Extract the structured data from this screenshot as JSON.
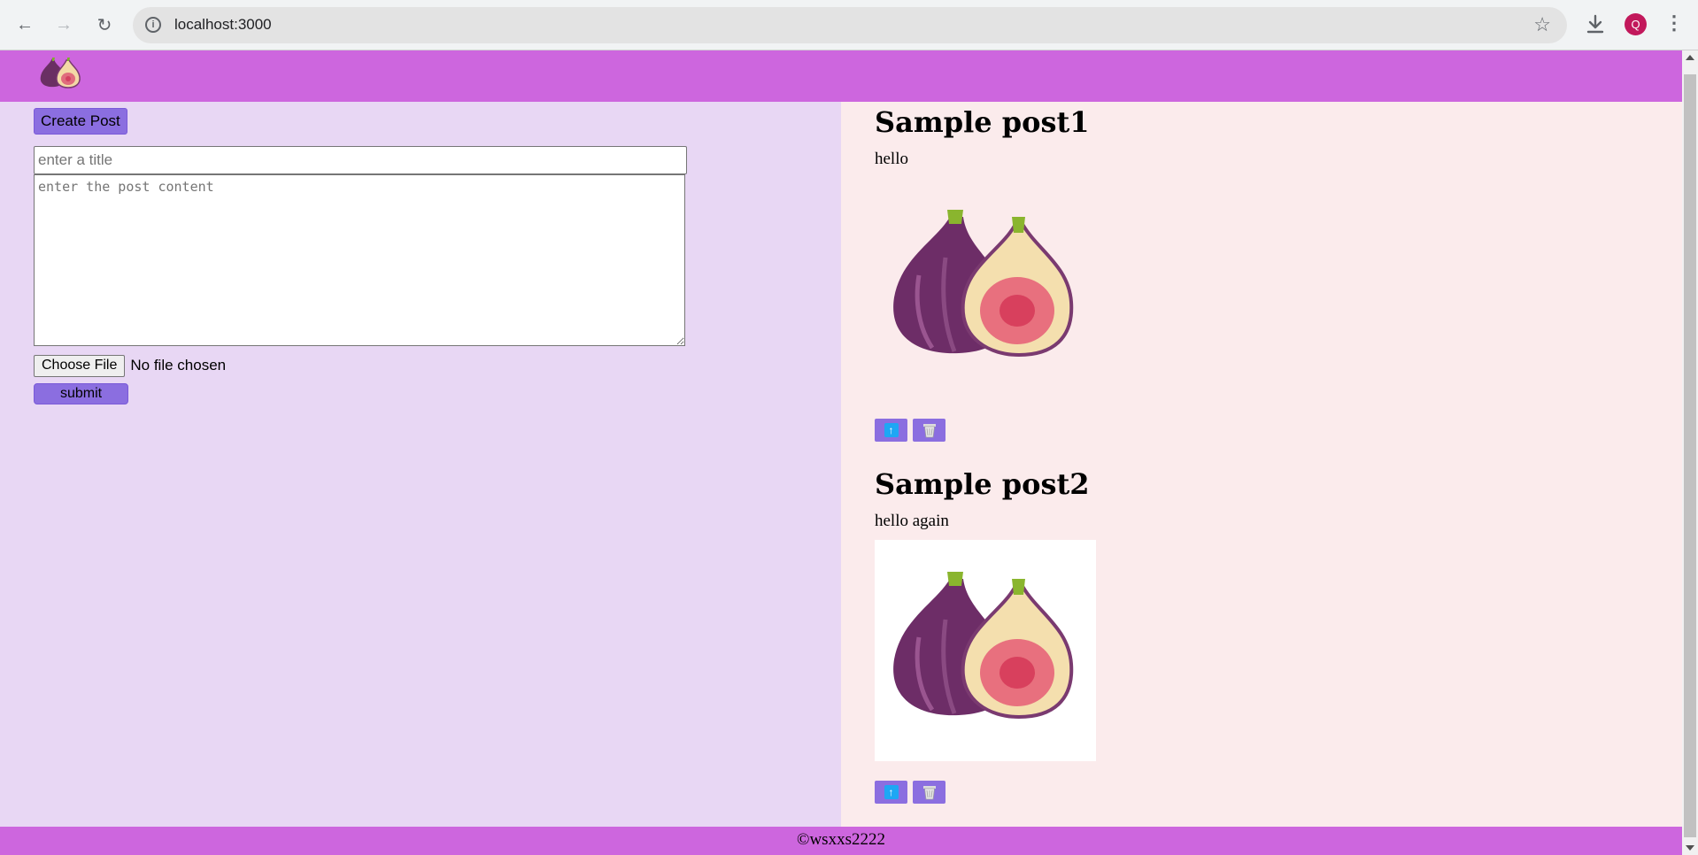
{
  "browser": {
    "url": "localhost:3000",
    "profile_initial": "Q"
  },
  "icons": {
    "back": "back-arrow-icon",
    "forward": "forward-arrow-icon",
    "reload": "reload-icon",
    "site_info": "info-icon",
    "bookmark": "star-icon",
    "download": "download-icon",
    "menu": "kebab-menu-icon",
    "logo": "fig-logo-icon",
    "upvote": "arrow-up-icon",
    "delete": "trash-icon"
  },
  "colors": {
    "header": "#cd66de",
    "left_pane": "#e8d7f4",
    "right_pane": "#fbebec",
    "button": "#8b6ee0"
  },
  "form": {
    "create_label": "Create Post",
    "title_placeholder": "enter a title",
    "content_placeholder": "enter the post content",
    "choose_file_label": "Choose File",
    "file_status": "No file chosen",
    "submit_label": "submit"
  },
  "posts": [
    {
      "title": "Sample post1",
      "body": "hello"
    },
    {
      "title": "Sample post2",
      "body": "hello again"
    }
  ],
  "footer": {
    "copyright": "©wsxxs2222"
  }
}
